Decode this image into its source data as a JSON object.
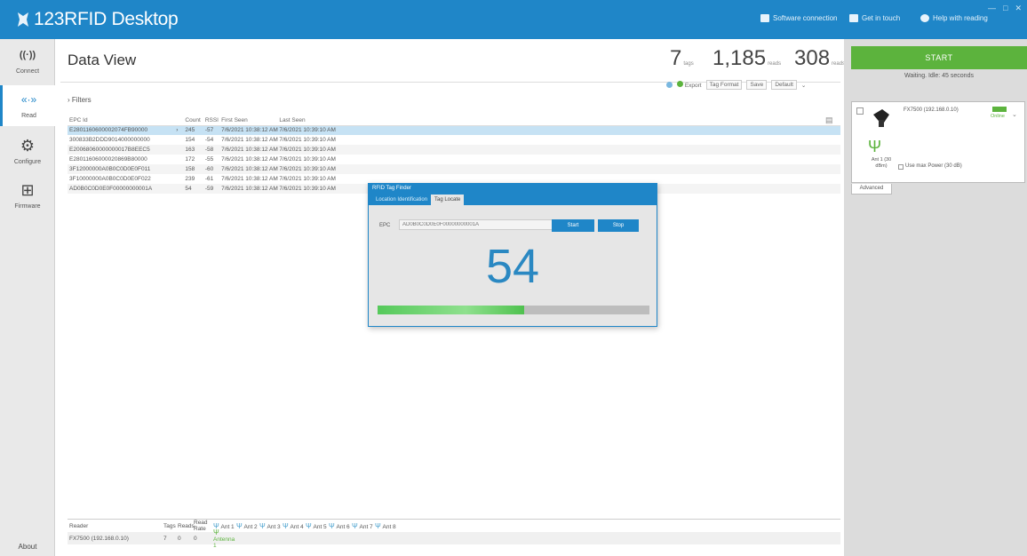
{
  "app": {
    "title": "123RFID Desktop"
  },
  "titlebar": {
    "items": [
      {
        "label": "Software connection"
      },
      {
        "label": "Get in touch"
      },
      {
        "label": "Help with reading"
      }
    ],
    "window_controls": [
      "—",
      "□",
      "✕"
    ]
  },
  "leftnav": {
    "items": [
      {
        "label": "Connect",
        "icon": "rfid-icon"
      },
      {
        "label": "Read",
        "icon": "read-waves-icon",
        "active": true
      },
      {
        "label": "Configure",
        "icon": "gear-icon"
      },
      {
        "label": "Firmware",
        "icon": "firmware-icon"
      }
    ],
    "about": "About"
  },
  "main": {
    "title": "Data View",
    "stats": [
      {
        "value": "7",
        "caption": "tags"
      },
      {
        "value": "1,185",
        "caption": "reads"
      },
      {
        "value": "308",
        "caption": "reads/sec"
      }
    ],
    "toolbar": {
      "export": "Export",
      "tag_format": "Tag Format",
      "save": "Save",
      "format_value": "Default"
    },
    "filters_label": "Filters",
    "table": {
      "columns": [
        "EPC Id",
        "",
        "Count",
        "RSSI",
        "First Seen",
        "Last Seen"
      ],
      "rows": [
        {
          "epc": "E2801160600002074FB90000",
          "count": "245",
          "rssi": "-57",
          "first": "7/6/2021 10:38:12 AM",
          "last": "7/6/2021 10:39:10 AM",
          "selected": true
        },
        {
          "epc": "300833B2DDD9014000000000",
          "count": "154",
          "rssi": "-54",
          "first": "7/6/2021 10:38:12 AM",
          "last": "7/6/2021 10:39:10 AM"
        },
        {
          "epc": "E20068060000000017B8EEC5",
          "count": "163",
          "rssi": "-58",
          "first": "7/6/2021 10:38:12 AM",
          "last": "7/6/2021 10:39:10 AM"
        },
        {
          "epc": "E28011606000020869B80000",
          "count": "172",
          "rssi": "-55",
          "first": "7/6/2021 10:38:12 AM",
          "last": "7/6/2021 10:39:10 AM"
        },
        {
          "epc": "3F12000000A0B0C0D0E0F011",
          "count": "158",
          "rssi": "-60",
          "first": "7/6/2021 10:38:12 AM",
          "last": "7/6/2021 10:39:10 AM"
        },
        {
          "epc": "3F10000000A0B0C0D0E0F022",
          "count": "239",
          "rssi": "-61",
          "first": "7/6/2021 10:38:12 AM",
          "last": "7/6/2021 10:39:10 AM"
        },
        {
          "epc": "AD0B0C0D0E0F00000000001A",
          "count": "54",
          "rssi": "-59",
          "first": "7/6/2021 10:38:12 AM",
          "last": "7/6/2021 10:39:10 AM"
        }
      ]
    },
    "reader_table": {
      "columns": [
        "Reader",
        "Tags",
        "Reads",
        "Read Rate",
        "Ant 1",
        "Ant 2",
        "Ant 3",
        "Ant 4",
        "Ant 5",
        "Ant 6",
        "Ant 7",
        "Ant 8"
      ],
      "row": {
        "reader": "FX7500 (192.168.0.10)",
        "tags": "7",
        "reads": "0",
        "read_rate": "0",
        "ant1": "Antenna 1"
      }
    }
  },
  "rightpanel": {
    "start_label": "START",
    "status": "Waiting. Idle: 45 seconds",
    "reader": {
      "name": "FX7500 (192.168.0.10)",
      "connection": "Online"
    },
    "antenna": {
      "label": "Ant 1 (30 dBm)"
    },
    "power_label": "Use max Power (30 dB)",
    "advanced_label": "Advanced"
  },
  "dialog": {
    "title": "RFID Tag Finder",
    "tabs": [
      "Location Identification",
      "Tag Locate"
    ],
    "active_tab": 1,
    "epc_label": "EPC",
    "epc_placeholder": "AD0B0C0D0E0F00000000001A",
    "start_label": "Start",
    "stop_label": "Stop",
    "count": "54",
    "proximity_percent": 54
  }
}
